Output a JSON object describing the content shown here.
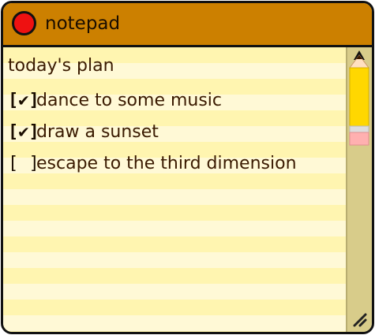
{
  "window": {
    "title": "notepad"
  },
  "note": {
    "heading": "today's plan",
    "items": [
      {
        "checkbox": "[✔]",
        "text": "dance to some music",
        "checked": true
      },
      {
        "checkbox": "[✔]",
        "text": "draw a sunset",
        "checked": true
      },
      {
        "checkbox": "[ ]",
        "text": "escape to the third dimension",
        "checked": false
      }
    ]
  },
  "icons": {
    "close": "close-icon",
    "scroll_up": "arrow-up-icon",
    "scroll_thumb": "pencil-icon",
    "resize": "resize-grip-icon"
  },
  "colors": {
    "titlebar": "#cc8000",
    "close_button": "#ee1111",
    "paper": "#fff5b0",
    "paper_stripe": "#fff9d6",
    "scrollbar": "#d8cc8a",
    "pencil_body": "#ffd700",
    "eraser": "#ffb0b0",
    "text": "#3a1a00"
  }
}
